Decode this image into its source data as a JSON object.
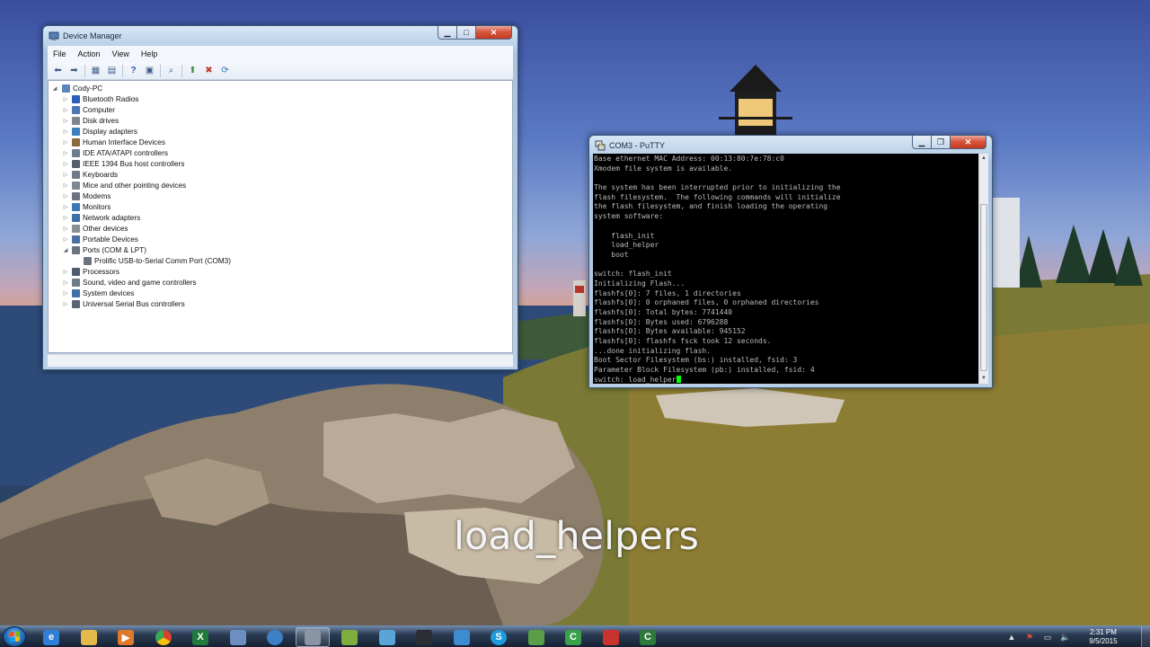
{
  "caption": "load_helpers",
  "device_manager": {
    "title": "Device Manager",
    "menus": [
      "File",
      "Action",
      "View",
      "Help"
    ],
    "toolbar_icons": [
      "back-icon",
      "forward-icon",
      "show-hide-console-tree-icon",
      "properties-icon",
      "help-icon",
      "update-driver-icon",
      "scan-hardware-icon",
      "uninstall-icon",
      "disable-icon",
      "enable-icon"
    ],
    "tree": {
      "root": "Cody-PC",
      "items": [
        {
          "label": "Bluetooth Radios",
          "icon": "bluetooth-icon",
          "color": "#2c5fb8"
        },
        {
          "label": "Computer",
          "icon": "computer-icon",
          "color": "#4b77b5"
        },
        {
          "label": "Disk drives",
          "icon": "disk-drive-icon",
          "color": "#7d8590"
        },
        {
          "label": "Display adapters",
          "icon": "display-adapter-icon",
          "color": "#3d7fc0"
        },
        {
          "label": "Human Interface Devices",
          "icon": "hid-icon",
          "color": "#8b6a3e"
        },
        {
          "label": "IDE ATA/ATAPI controllers",
          "icon": "ide-controller-icon",
          "color": "#6d7d8e"
        },
        {
          "label": "IEEE 1394 Bus host controllers",
          "icon": "firewire-icon",
          "color": "#555f6b"
        },
        {
          "label": "Keyboards",
          "icon": "keyboard-icon",
          "color": "#6f7b88"
        },
        {
          "label": "Mice and other pointing devices",
          "icon": "mouse-icon",
          "color": "#7f8790"
        },
        {
          "label": "Modems",
          "icon": "modem-icon",
          "color": "#6b7480"
        },
        {
          "label": "Monitors",
          "icon": "monitor-icon",
          "color": "#3c78b8"
        },
        {
          "label": "Network adapters",
          "icon": "network-adapter-icon",
          "color": "#3a6fa8"
        },
        {
          "label": "Other devices",
          "icon": "other-devices-icon",
          "color": "#8a8f96"
        },
        {
          "label": "Portable Devices",
          "icon": "portable-device-icon",
          "color": "#4a6fa0"
        },
        {
          "label": "Ports (COM & LPT)",
          "icon": "port-icon",
          "color": "#6a7480",
          "expanded": true
        },
        {
          "label": "Prolific USB-to-Serial Comm Port (COM3)",
          "icon": "port-icon",
          "color": "#6a7480",
          "child": true
        },
        {
          "label": "Processors",
          "icon": "processor-icon",
          "color": "#4d5c6e"
        },
        {
          "label": "Sound, video and game controllers",
          "icon": "sound-icon",
          "color": "#6d7a8a"
        },
        {
          "label": "System devices",
          "icon": "system-device-icon",
          "color": "#3f6fa9"
        },
        {
          "label": "Universal Serial Bus controllers",
          "icon": "usb-icon",
          "color": "#5b6573"
        }
      ]
    }
  },
  "putty": {
    "title": "COM3 - PuTTY",
    "lines": [
      "Base ethernet MAC Address: 00:13:80:7e:78:c0",
      "Xmodem file system is available.",
      "",
      "The system has been interrupted prior to initializing the",
      "flash filesystem.  The following commands will initialize",
      "the flash filesystem, and finish loading the operating",
      "system software:",
      "",
      "    flash_init",
      "    load_helper",
      "    boot",
      "",
      "switch: flash_init",
      "Initializing Flash...",
      "flashfs[0]: 7 files, 1 directories",
      "flashfs[0]: 0 orphaned files, 0 orphaned directories",
      "flashfs[0]: Total bytes: 7741440",
      "flashfs[0]: Bytes used: 6796288",
      "flashfs[0]: Bytes available: 945152",
      "flashfs[0]: flashfs fsck took 12 seconds.",
      "...done initializing flash.",
      "Boot Sector Filesystem (bs:) installed, fsid: 3",
      "Parameter Block Filesystem (pb:) installed, fsid: 4"
    ],
    "prompt_line": "switch: load_helper"
  },
  "taskbar": {
    "items": [
      {
        "name": "internet-explorer-icon",
        "glyph": "e",
        "color": "#2f7fd6"
      },
      {
        "name": "windows-explorer-icon",
        "glyph": "",
        "color": "#e3b949"
      },
      {
        "name": "media-player-icon",
        "glyph": "▶",
        "color": "#e0782a"
      },
      {
        "name": "chrome-icon",
        "glyph": "",
        "color": "#d9412e"
      },
      {
        "name": "excel-icon",
        "glyph": "X",
        "color": "#1f7a3c"
      },
      {
        "name": "network-app-icon",
        "glyph": "",
        "color": "#6d8fbf"
      },
      {
        "name": "globe-app-icon",
        "glyph": "",
        "color": "#3b7fc4"
      },
      {
        "name": "putty-icon",
        "glyph": "",
        "color": "#8a96a6"
      },
      {
        "name": "notepad-icon",
        "glyph": "",
        "color": "#7fae3f"
      },
      {
        "name": "blue-app-icon",
        "glyph": "",
        "color": "#5aa5d8"
      },
      {
        "name": "terminal-icon",
        "glyph": "",
        "color": "#2a2e33"
      },
      {
        "name": "remote-desktop-icon",
        "glyph": "",
        "color": "#3d8cd0"
      },
      {
        "name": "skype-icon",
        "glyph": "S",
        "color": "#1e9bde"
      },
      {
        "name": "green-folder-icon",
        "glyph": "",
        "color": "#5a9f48"
      },
      {
        "name": "camtasia-icon",
        "glyph": "C",
        "color": "#3aa04a"
      },
      {
        "name": "red-app-icon",
        "glyph": "",
        "color": "#c8342d"
      },
      {
        "name": "camtasia-recorder-icon",
        "glyph": "C",
        "color": "#2f7a3a"
      }
    ],
    "clock_time": "2:31 PM",
    "clock_date": "9/5/2015"
  }
}
